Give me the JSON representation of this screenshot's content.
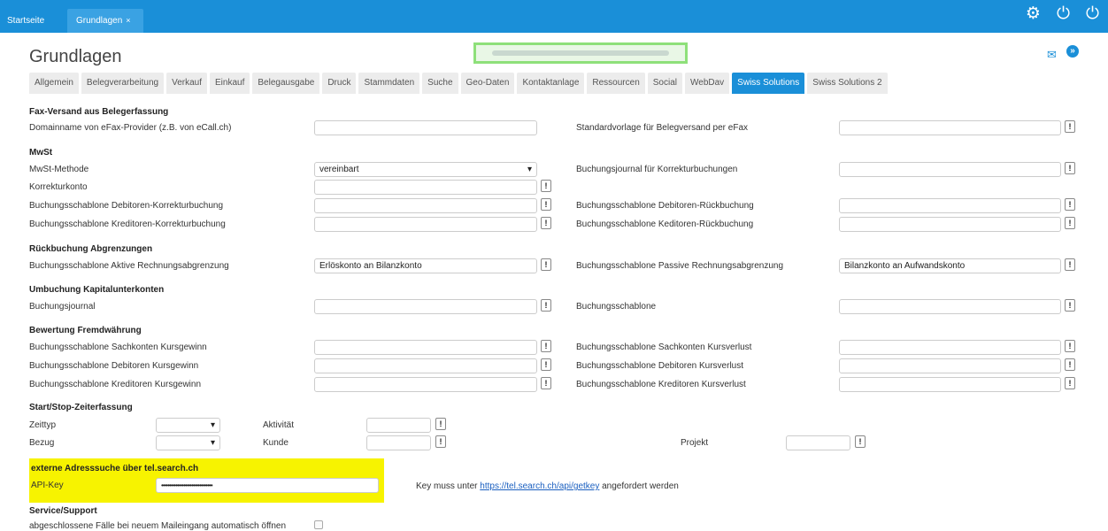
{
  "topbar": {
    "tabs": [
      {
        "label": "Startseite"
      },
      {
        "label": "Grundlagen",
        "close": "×"
      }
    ],
    "icons": [
      "gear-icon",
      "power-icon",
      "power-plus-icon"
    ]
  },
  "page": {
    "title": "Grundlagen",
    "mail_icon": "mail-icon",
    "chat_icon": "chat-icon"
  },
  "tabs": [
    "Allgemein",
    "Belegverarbeitung",
    "Verkauf",
    "Einkauf",
    "Belegausgabe",
    "Druck",
    "Stammdaten",
    "Suche",
    "Geo-Daten",
    "Kontaktanlage",
    "Ressourcen",
    "Social",
    "WebDav",
    "Swiss Solutions",
    "Swiss Solutions 2"
  ],
  "active_tab": "Swiss Solutions",
  "fax": {
    "heading": "Fax-Versand aus Belegerfassung",
    "domain_label": "Domainname von eFax-Provider (z.B. von eCall.ch)",
    "template_label": "Standardvorlage für Belegversand per eFax"
  },
  "mwst": {
    "heading": "MwSt",
    "method_label": "MwSt-Methode",
    "method_value": "vereinbart",
    "journal_label": "Buchungsjournal für Korrekturbuchungen",
    "konto_label": "Korrekturkonto",
    "deb_korr_label": "Buchungsschablone Debitoren-Korrekturbuchung",
    "deb_rueck_label": "Buchungsschablone Debitoren-Rückbuchung",
    "kred_korr_label": "Buchungsschablone Kreditoren-Korrekturbuchung",
    "kred_rueck_label": "Buchungsschablone Keditoren-Rückbuchung"
  },
  "rueck": {
    "heading": "Rückbuchung Abgrenzungen",
    "aktive_label": "Buchungsschablone Aktive Rechnungsabgrenzung",
    "aktive_value": "Erlöskonto an Bilanzkonto",
    "passive_label": "Buchungsschablone Passive Rechnungsabgrenzung",
    "passive_value": "Bilanzkonto an Aufwandskonto"
  },
  "umbuchung": {
    "heading": "Umbuchung Kapitalunterkonten",
    "journal_label": "Buchungsjournal",
    "schablone_label": "Buchungsschablone"
  },
  "bewertung": {
    "heading": "Bewertung Fremdwährung",
    "rows": [
      {
        "left": "Buchungsschablone Sachkonten Kursgewinn",
        "right": "Buchungsschablone Sachkonten Kursverlust"
      },
      {
        "left": "Buchungsschablone Debitoren Kursgewinn",
        "right": "Buchungsschablone Debitoren Kursverlust"
      },
      {
        "left": "Buchungsschablone Kreditoren Kursgewinn",
        "right": "Buchungsschablone Kreditoren Kursverlust"
      }
    ]
  },
  "zeit": {
    "heading": "Start/Stop-Zeiterfassung",
    "zeittyp": "Zeittyp",
    "aktivitaet": "Aktivität",
    "bezug": "Bezug",
    "kunde": "Kunde",
    "projekt": "Projekt"
  },
  "tel": {
    "heading": "externe Adresssuche über tel.search.ch",
    "api_label": "API-Key",
    "api_value": "••••••••••••••••••••••••••••••••",
    "hint_pre": "Key muss unter ",
    "hint_link": "https://tel.search.ch/api/getkey",
    "hint_post": " angefordert werden"
  },
  "service": {
    "heading": "Service/Support",
    "auto_open_label": "abgeschlossene Fälle bei neuem Maileingang automatisch öffnen"
  },
  "button_glyph": "!",
  "colors": {
    "accent": "#1a8fd8",
    "highlight": "#f7f300",
    "focus_box": "#8ee07a"
  }
}
